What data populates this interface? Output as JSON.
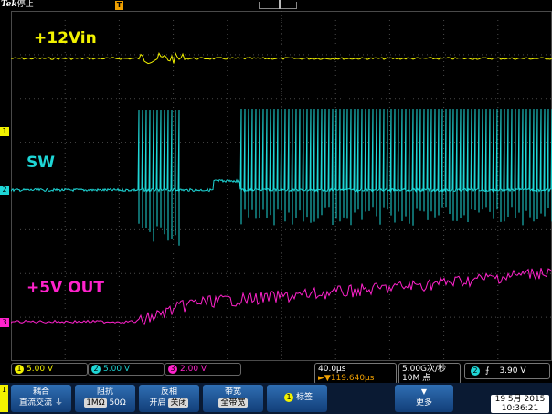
{
  "topbar": {
    "brand": "Tek",
    "status": "停止"
  },
  "waveforms": {
    "ch1_label": "+12Vin",
    "ch2_label": "SW",
    "ch3_label": "+5V OUT"
  },
  "markers": {
    "trigger_marker": "T",
    "ch1_marker": "1",
    "ch2_marker": "2",
    "ch3_marker": "3"
  },
  "measurements": {
    "ch1": {
      "num": "1",
      "scale": "5.00 V"
    },
    "ch2": {
      "num": "2",
      "scale": "5.00 V"
    },
    "ch3": {
      "num": "3",
      "scale": "2.00 V"
    },
    "timebase": "40.0µs",
    "trigger_offset": "►▼119.640µs",
    "sample_rate": "5.00G次/秒",
    "record_length": "10M 点",
    "trigger_ch": "2",
    "trigger_level": "3.90 V"
  },
  "softkeys": {
    "menu_marker": "1",
    "coupling_title": "耦合",
    "coupling_options": [
      "直流",
      "交流"
    ],
    "impedance_title": "阻抗",
    "impedance_options": [
      "1MΩ",
      "50Ω"
    ],
    "invert_title": "反相",
    "invert_options": [
      "开启",
      "关闭"
    ],
    "bandwidth_title": "带宽",
    "bandwidth_value": "全带宽",
    "label_num": "1",
    "label_title": "标签",
    "more": "更多"
  },
  "datetime": {
    "date": "19 5月 2015",
    "time": "10:36:21"
  },
  "colors": {
    "ch1": "#f2f200",
    "ch2": "#1ed6d6",
    "ch3": "#ff22cc",
    "grid": "#4a4a4a"
  }
}
